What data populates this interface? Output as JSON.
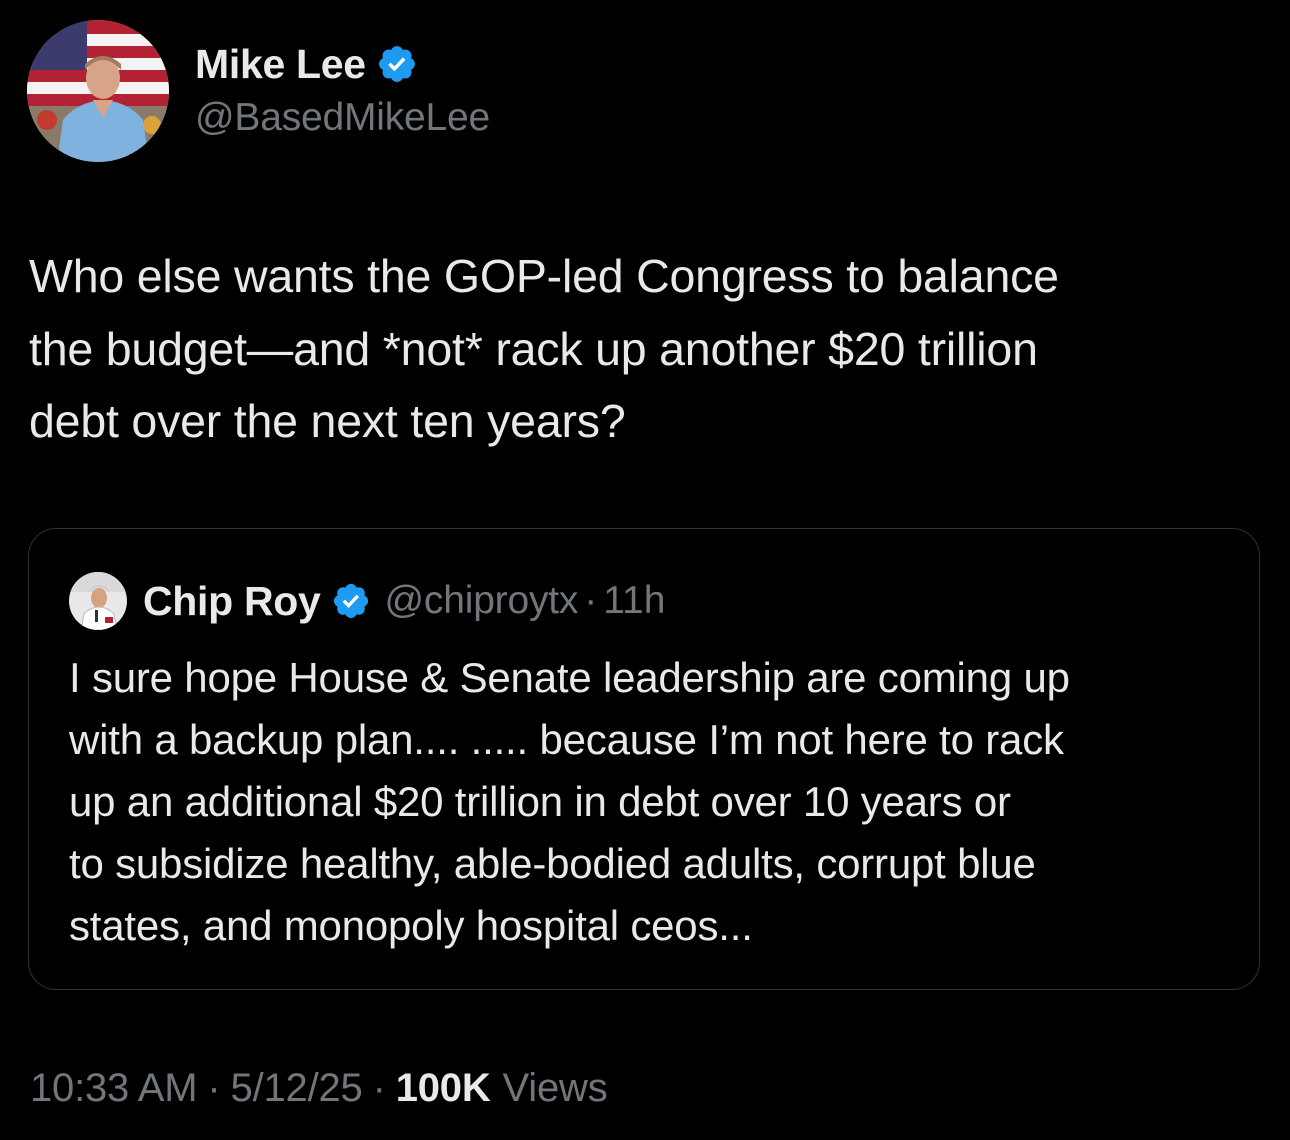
{
  "author": {
    "display_name": "Mike Lee",
    "handle": "@BasedMikeLee",
    "verified_icon": "verified-badge-icon"
  },
  "tweet": {
    "text": "Who else wants the GOP-led Congress to balance\nthe budget—and *not* rack up another $20 trillion\ndebt over the next ten years?"
  },
  "quote": {
    "display_name": "Chip Roy",
    "handle": "@chiproytx",
    "separator": "·",
    "time": "11h",
    "verified_icon": "verified-badge-icon",
    "text": "I sure hope House & Senate leadership are coming up\nwith a backup plan.... ..... because I’m not here to rack\nup an additional $20 trillion in debt over 10 years or\nto subsidize healthy, able-bodied adults, corrupt blue\nstates, and monopoly hospital ceos..."
  },
  "meta": {
    "time": "10:33 AM",
    "date": "5/12/25",
    "separator": "·",
    "views_count": "100K",
    "views_label": "Views"
  },
  "colors": {
    "background": "#000000",
    "text_primary": "#e7e9ea",
    "text_secondary": "#71767b",
    "verified_blue": "#1d9bf0",
    "border": "#2f3336"
  }
}
